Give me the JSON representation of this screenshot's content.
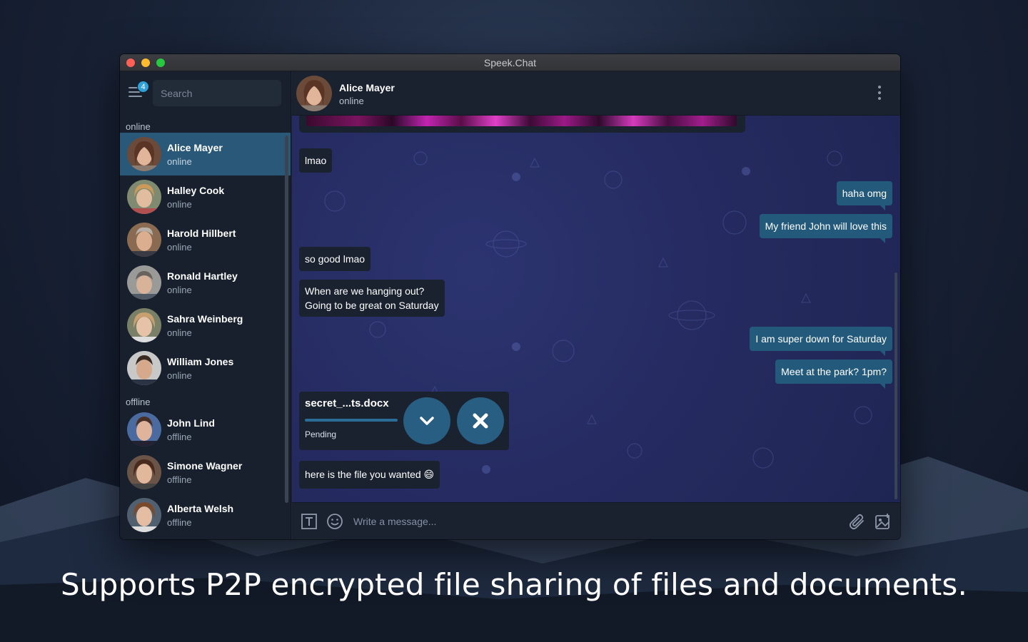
{
  "window": {
    "title": "Speek.Chat"
  },
  "sidebar": {
    "badge_count": "4",
    "search_placeholder": "Search",
    "online_label": "online",
    "offline_label": "offline",
    "online_contacts": [
      {
        "name": "Alice Mayer",
        "status": "online"
      },
      {
        "name": "Halley Cook",
        "status": "online"
      },
      {
        "name": "Harold Hillbert",
        "status": "online"
      },
      {
        "name": "Ronald Hartley",
        "status": "online"
      },
      {
        "name": "Sahra Weinberg",
        "status": "online"
      },
      {
        "name": "William Jones",
        "status": "online"
      }
    ],
    "offline_contacts": [
      {
        "name": "John Lind",
        "status": "offline"
      },
      {
        "name": "Simone Wagner",
        "status": "offline"
      },
      {
        "name": "Alberta Welsh",
        "status": "offline"
      }
    ]
  },
  "chat": {
    "contact_name": "Alice Mayer",
    "contact_status": "online",
    "messages": [
      {
        "dir": "in",
        "text": "lmao"
      },
      {
        "dir": "out",
        "text": "haha omg"
      },
      {
        "dir": "out",
        "text": "My friend John will love this"
      },
      {
        "dir": "in",
        "text": "so good lmao"
      },
      {
        "dir": "in",
        "text": "When are we hanging out?"
      },
      {
        "dir": "in",
        "text": "Going to be great on Saturday"
      },
      {
        "dir": "out",
        "text": "I am super down for Saturday"
      },
      {
        "dir": "out",
        "text": "Meet at the park? 1pm?"
      },
      {
        "dir": "in",
        "text": "here is the file you wanted 😄"
      }
    ],
    "file_transfer": {
      "file_name": "secret_...ts.docx",
      "status": "Pending"
    },
    "composer_placeholder": "Write a message..."
  },
  "tagline": "Supports P2P encrypted file sharing of files and documents.",
  "colors": {
    "accent": "#2fa0d8",
    "active_contact": "#2a5878",
    "outgoing_bubble": "#235a7c",
    "incoming_bubble": "#1a2230"
  },
  "icons": [
    "menu-icon",
    "kebab-icon",
    "text-format-icon",
    "emoji-icon",
    "paperclip-icon",
    "image-icon",
    "checkmark-icon",
    "close-icon"
  ]
}
